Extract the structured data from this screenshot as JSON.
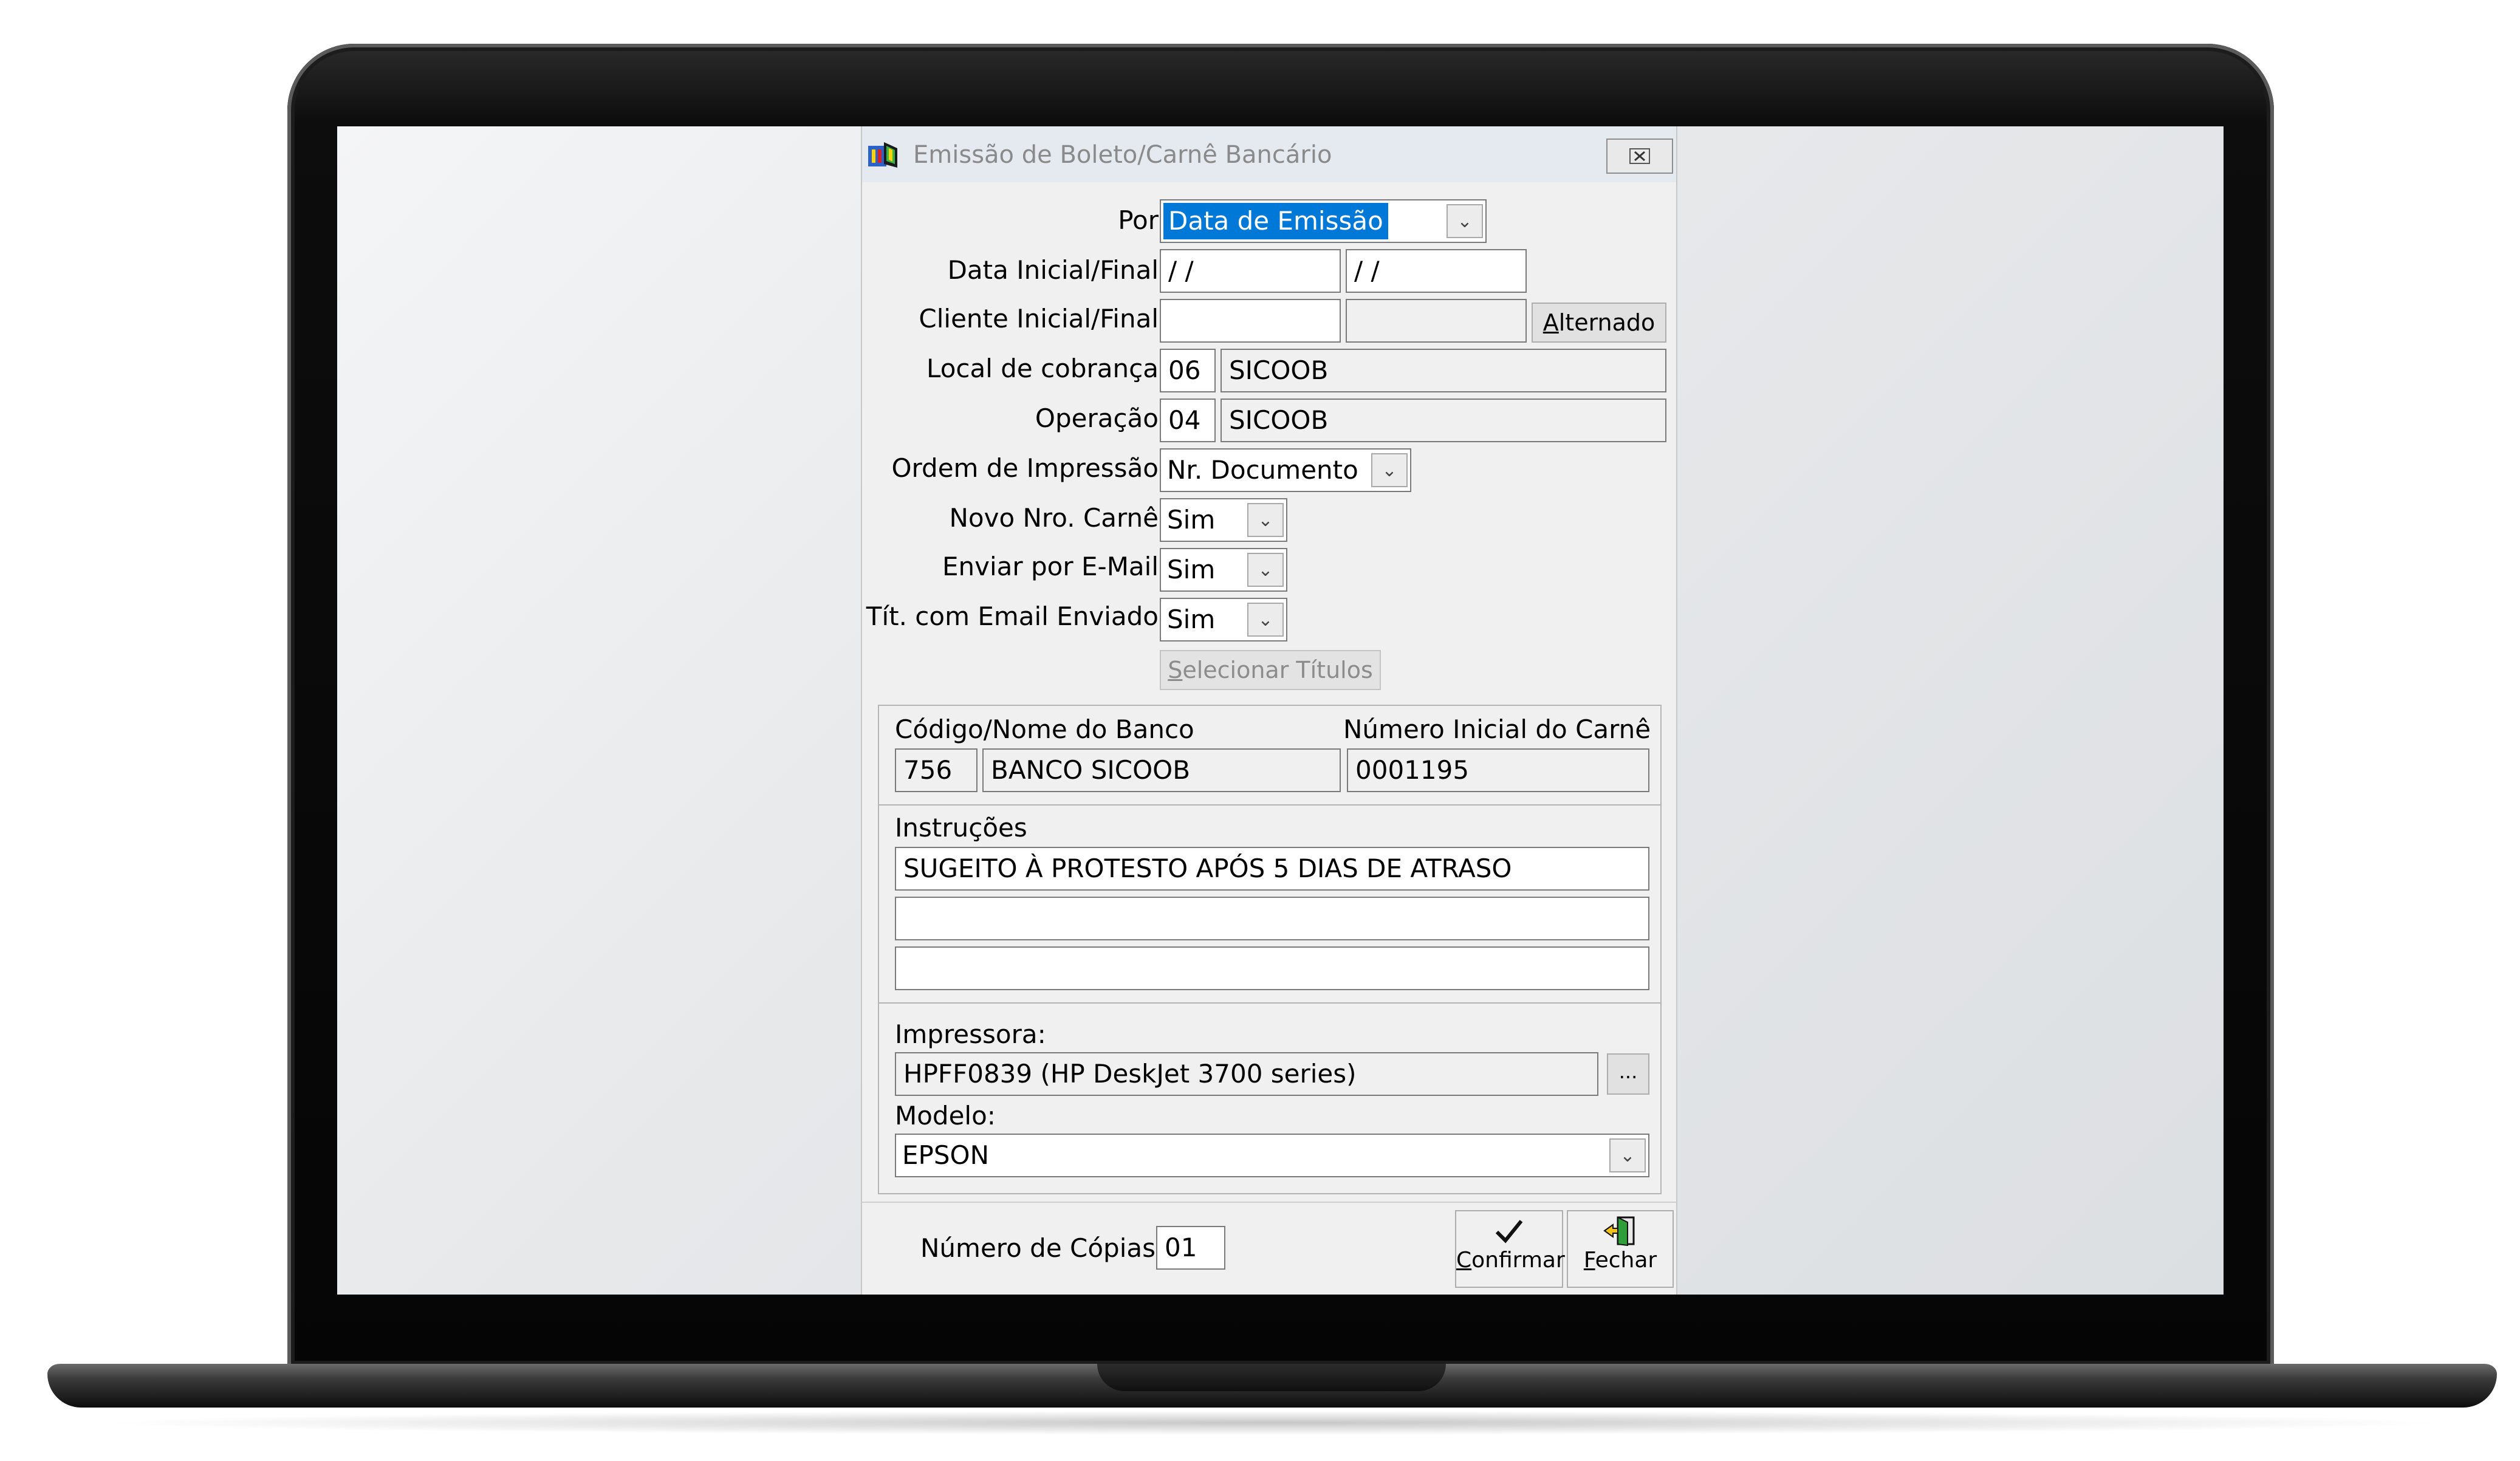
{
  "window": {
    "title": "Emissão de Boleto/Carnê Bancário",
    "close_icon": "close-icon"
  },
  "form": {
    "por": {
      "label": "Por",
      "value": "Data de Emissão"
    },
    "data": {
      "label": "Data Inicial/Final",
      "inicial": "/ /",
      "final": "/ /"
    },
    "cliente": {
      "label": "Cliente Inicial/Final",
      "inicial": "",
      "final": "",
      "button": "Alternado",
      "button_accel": "A",
      "button_rest": "lternado"
    },
    "local": {
      "label": "Local de cobrança",
      "code": "06",
      "name": "SICOOB"
    },
    "operacao": {
      "label": "Operação",
      "code": "04",
      "name": "SICOOB"
    },
    "ordem": {
      "label": "Ordem de Impressão",
      "value": "Nr. Documento"
    },
    "novo_carne": {
      "label": "Novo Nro. Carnê",
      "value": "Sim"
    },
    "enviar_email": {
      "label": "Enviar por E-Mail",
      "value": "Sim"
    },
    "tit_email": {
      "label": "Tít. com Email Enviado",
      "value": "Sim"
    },
    "selecionar": {
      "label": "Selecionar Títulos",
      "accel": "S",
      "rest": "elecionar Títulos"
    }
  },
  "banco": {
    "label": "Código/Nome do Banco",
    "code": "756",
    "name": "BANCO SICOOB",
    "carne_label": "Número Inicial do Carnê",
    "carne_value": "0001195"
  },
  "instrucoes": {
    "label": "Instruções",
    "lines": [
      "SUGEITO À PROTESTO APÓS 5 DIAS DE ATRASO",
      "",
      ""
    ]
  },
  "impressora": {
    "label": "Impressora:",
    "value": "HPFF0839 (HP DeskJet 3700 series)",
    "browse": "...",
    "modelo_label": "Modelo:",
    "modelo_value": "EPSON"
  },
  "footer": {
    "copias_label": "Número de Cópias:",
    "copias_value": "01",
    "confirmar_accel": "C",
    "confirmar_rest": "onfirmar",
    "fechar_accel": "F",
    "fechar_rest": "echar"
  }
}
